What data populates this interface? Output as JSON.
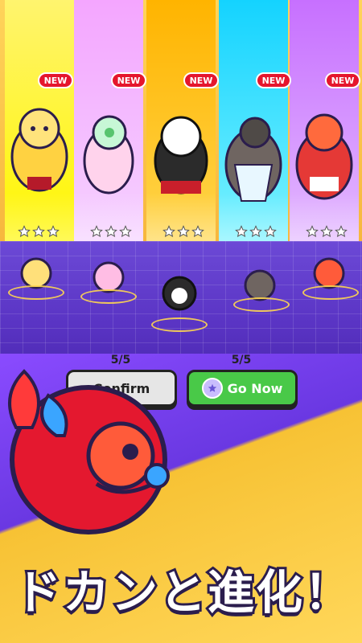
{
  "cards": [
    {
      "badge": "NEW",
      "color": "#fff36b",
      "creature": "yellow-fox"
    },
    {
      "badge": "NEW",
      "color": "#f7b3ff",
      "creature": "pink-lizard"
    },
    {
      "badge": "NEW",
      "color": "#ffcc2c",
      "creature": "black-red-dog"
    },
    {
      "badge": "NEW",
      "color": "#47e3ff",
      "creature": "blue-dragon"
    },
    {
      "badge": "NEW",
      "color": "#c879ff",
      "creature": "red-fox"
    }
  ],
  "progress": [
    {
      "text": "5/5"
    },
    {
      "text": "5/5"
    }
  ],
  "buttons": {
    "confirm": "Confirm",
    "go_now": "Go Now"
  },
  "headline": "ドカンと進化！",
  "colors": {
    "badge": "#e5162d",
    "go_button": "#49c948",
    "confirm_button": "#e6e6e6",
    "headline_outline": "#2b1d4d"
  }
}
